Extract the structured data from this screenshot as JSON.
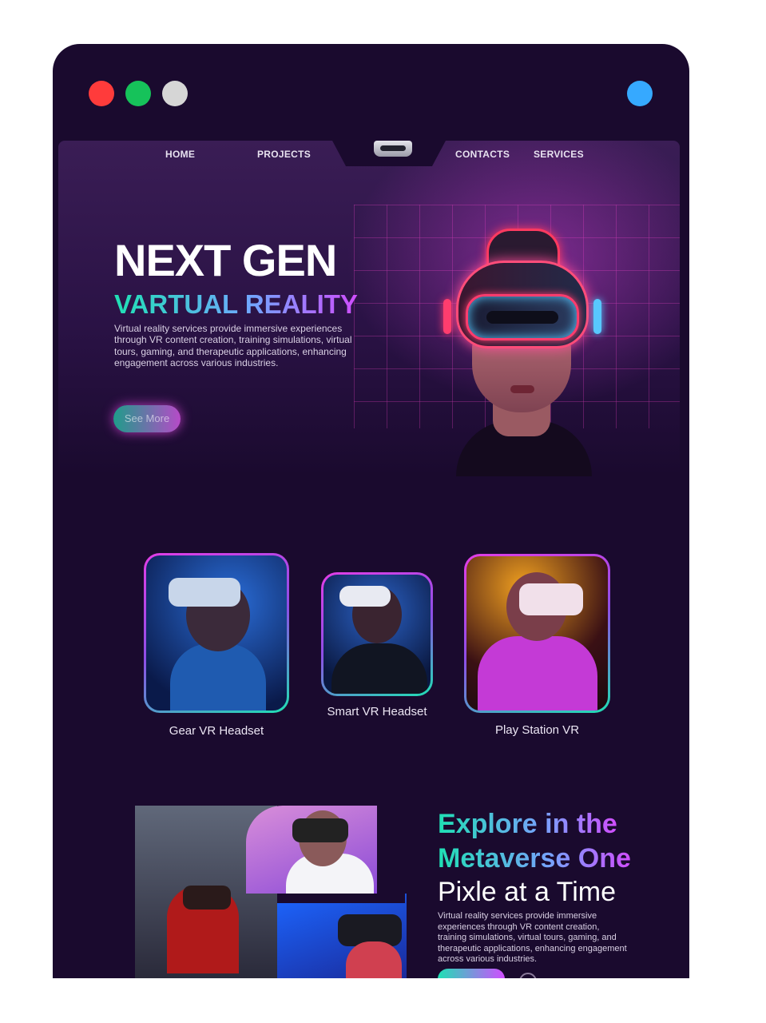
{
  "window": {
    "controls": [
      "close",
      "minimize",
      "maximize"
    ],
    "colors": {
      "close": "#ff3b3b",
      "minimize": "#16c25a",
      "maximize": "#d6d6d6",
      "indicator": "#36a9ff"
    }
  },
  "nav": {
    "home": "HOME",
    "projects": "PROJECTS",
    "contacts": "CONTACTS",
    "services": "SERVICES",
    "logo_icon": "vr-headset-icon"
  },
  "hero": {
    "title": "NEXT GEN",
    "subtitle": "VARTUAL REALITY",
    "description": "Virtual reality services provide immersive experiences through VR content creation, training simulations, virtual tours, gaming, and therapeutic applications, enhancing engagement across various industries.",
    "cta": "See More"
  },
  "products": [
    {
      "label": "Gear VR Headset"
    },
    {
      "label": "Smart VR Headset"
    },
    {
      "label": "Play Station VR"
    }
  ],
  "explore": {
    "title_line1": "Explore in the",
    "title_line2": "Metaverse One",
    "title_line3": "Pixle at a Time",
    "description": "Virtual reality services provide immersive experiences through VR content creation, training simulations, virtual tours, gaming, and therapeutic applications, enhancing engagement across various industries."
  },
  "theme": {
    "background": "#1a0a2e",
    "accent_teal": "#1fe0b4",
    "accent_magenta": "#d04dff"
  }
}
